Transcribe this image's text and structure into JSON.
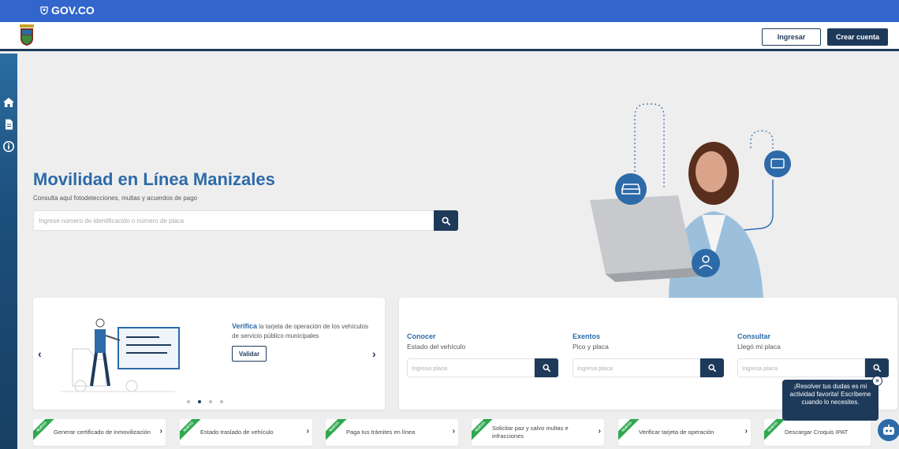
{
  "gov_bar": {
    "logo_text": "GOV.CO"
  },
  "header": {
    "logo_icon": "alcaldia-shield",
    "login_label": "Ingresar",
    "signup_label": "Crear cuenta"
  },
  "sidebar": {
    "items": [
      {
        "icon": "home-icon"
      },
      {
        "icon": "document-icon"
      },
      {
        "icon": "info-icon"
      }
    ]
  },
  "hero": {
    "title": "Movilidad en Línea Manizales",
    "subtitle": "Consulta aquí fotodetecciones, multas y acuerdos de pago",
    "search_placeholder": "Ingrese número de identificación o número de placa"
  },
  "carousel": {
    "slide_title": "Verifica",
    "slide_text": " la tarjeta de operación de los vehículos de servicio público municipales",
    "button_label": "Validar",
    "prev": "‹",
    "next": "›",
    "dot_count": 4,
    "active_dot": 1
  },
  "quick": [
    {
      "title": "Conocer",
      "subtitle": "Estado del vehículo",
      "placeholder": "Ingresa placa"
    },
    {
      "title": "Exentos",
      "subtitle": "Pico y placa",
      "placeholder": "Ingresa placa"
    },
    {
      "title": "Consultar",
      "subtitle": "Llegó mi placa",
      "placeholder": "Ingresa placa"
    }
  ],
  "tiles": [
    {
      "badge": "NUEVO",
      "label": "Generar certificado de inmovilización"
    },
    {
      "badge": "NUEVO",
      "label": "Estado traslado de vehículo"
    },
    {
      "badge": "NUEVO",
      "label": "Paga tus trámites en línea"
    },
    {
      "badge": "NUEVO",
      "label": "Solicitar paz y salvo multas e infracciones"
    },
    {
      "badge": "NUEVO",
      "label": "Verificar tarjeta de operación"
    },
    {
      "badge": "NUEVO",
      "label": "Descargar Croquis IPAT"
    }
  ],
  "chat": {
    "message": "¡Resolver tus dudas es mi actividad favorita! Escríbeme cuando lo necesites.",
    "close": "×"
  },
  "colors": {
    "gov_blue": "#3366cc",
    "navy": "#1d3a5a",
    "title_blue": "#2d6aa8",
    "badge_green": "#2fa84f"
  }
}
